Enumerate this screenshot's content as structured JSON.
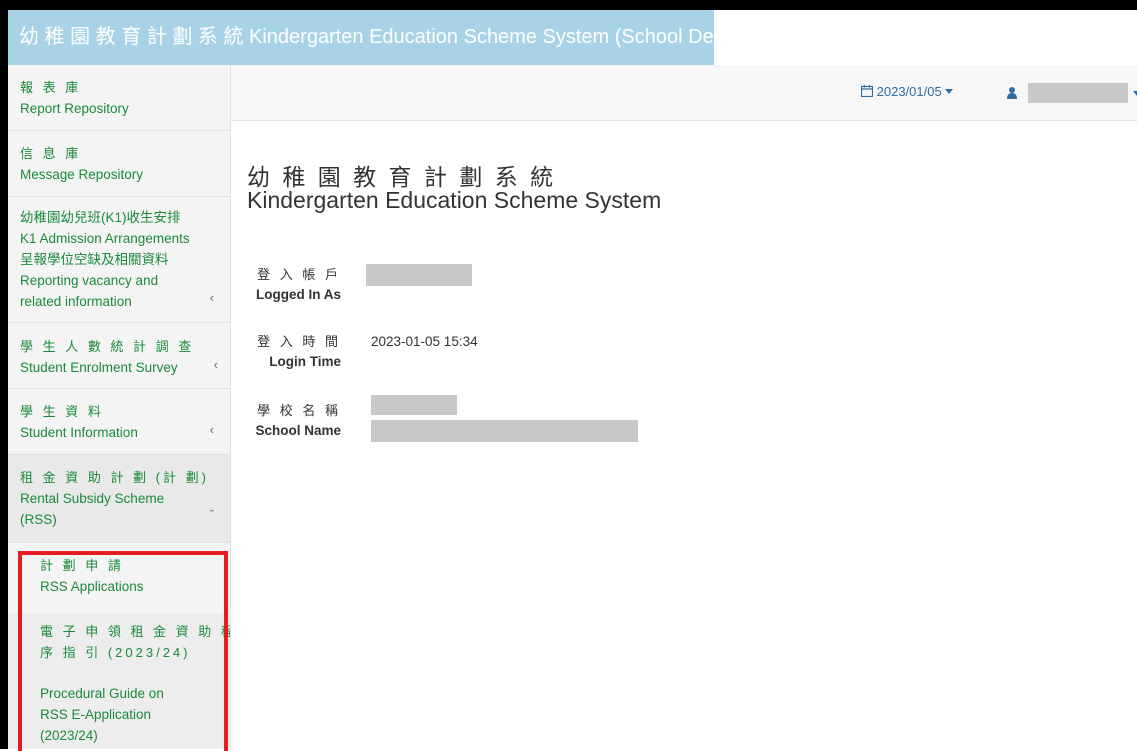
{
  "app": {
    "title": "幼 稚 園 教 育 計 劃 系 統 Kindergarten Education Scheme System (School Desk)"
  },
  "topbar": {
    "date": "2023/01/05",
    "user_name": ""
  },
  "sidebar": {
    "items": [
      {
        "zh": "報 表 庫",
        "en": "Report Repository",
        "chevron": ""
      },
      {
        "zh": "信 息 庫",
        "en": "Message Repository",
        "chevron": ""
      },
      {
        "lines": [
          "幼稚園幼兒班(K1)收生安排",
          "K1 Admission Arrangements",
          "呈報學位空缺及相關資料",
          "Reporting vacancy and",
          "related information"
        ],
        "chevron": "‹"
      },
      {
        "zh": "學 生 人 數 統 計 調 查",
        "en": "Student Enrolment Survey",
        "chevron": "‹"
      },
      {
        "zh": "學 生 資 料",
        "en": "Student Information",
        "chevron": "‹"
      },
      {
        "lines": [
          "租 金 資 助 計 劃 (計 劃)",
          "Rental Subsidy Scheme",
          "(RSS)"
        ],
        "chevron": "ˇ"
      }
    ],
    "sub_items": [
      {
        "lines": [
          "計 劃 申 請",
          "RSS Applications"
        ]
      },
      {
        "lines": [
          "電 子 申 領 租 金 資 助 程",
          "序 指 引 (2023/24)"
        ]
      },
      {
        "lines": [
          "Procedural Guide on",
          "RSS E-Application",
          "(2023/24)"
        ]
      }
    ]
  },
  "main": {
    "title_zh": "幼 稚 園 教 育 計 劃 系 統",
    "title_en": "Kindergarten Education Scheme System",
    "fields": [
      {
        "label_zh": "登 入 帳 戶",
        "label_en": "Logged In As",
        "value": ""
      },
      {
        "label_zh": "登 入 時 間",
        "label_en": "Login Time",
        "value": "2023-01-05 15:34"
      },
      {
        "label_zh": "學 校 名 稱",
        "label_en": "School Name",
        "value": ""
      }
    ]
  },
  "icons": {
    "calendar": "calendar-icon",
    "user": "user-icon",
    "caret": "caret-down-icon"
  },
  "colors": {
    "title_bg": "#a8d3e6",
    "nav_link": "#1a8a3a",
    "date_link": "#2e6da4",
    "highlight": "#e31b23"
  }
}
